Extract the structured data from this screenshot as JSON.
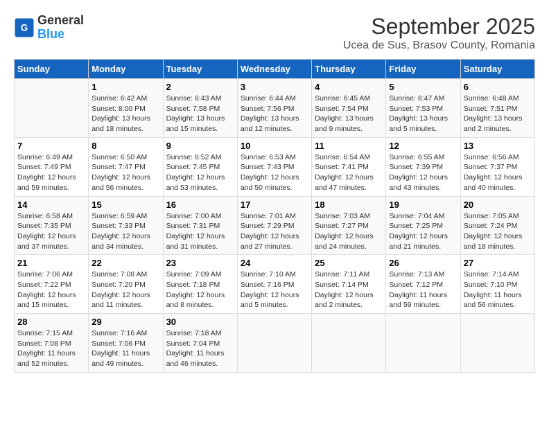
{
  "logo": {
    "general": "General",
    "blue": "Blue"
  },
  "title": "September 2025",
  "subtitle": "Ucea de Sus, Brasov County, Romania",
  "days_of_week": [
    "Sunday",
    "Monday",
    "Tuesday",
    "Wednesday",
    "Thursday",
    "Friday",
    "Saturday"
  ],
  "weeks": [
    [
      {
        "day": "",
        "info": ""
      },
      {
        "day": "1",
        "info": "Sunrise: 6:42 AM\nSunset: 8:00 PM\nDaylight: 13 hours\nand 18 minutes."
      },
      {
        "day": "2",
        "info": "Sunrise: 6:43 AM\nSunset: 7:58 PM\nDaylight: 13 hours\nand 15 minutes."
      },
      {
        "day": "3",
        "info": "Sunrise: 6:44 AM\nSunset: 7:56 PM\nDaylight: 13 hours\nand 12 minutes."
      },
      {
        "day": "4",
        "info": "Sunrise: 6:45 AM\nSunset: 7:54 PM\nDaylight: 13 hours\nand 9 minutes."
      },
      {
        "day": "5",
        "info": "Sunrise: 6:47 AM\nSunset: 7:53 PM\nDaylight: 13 hours\nand 5 minutes."
      },
      {
        "day": "6",
        "info": "Sunrise: 6:48 AM\nSunset: 7:51 PM\nDaylight: 13 hours\nand 2 minutes."
      }
    ],
    [
      {
        "day": "7",
        "info": "Sunrise: 6:49 AM\nSunset: 7:49 PM\nDaylight: 12 hours\nand 59 minutes."
      },
      {
        "day": "8",
        "info": "Sunrise: 6:50 AM\nSunset: 7:47 PM\nDaylight: 12 hours\nand 56 minutes."
      },
      {
        "day": "9",
        "info": "Sunrise: 6:52 AM\nSunset: 7:45 PM\nDaylight: 12 hours\nand 53 minutes."
      },
      {
        "day": "10",
        "info": "Sunrise: 6:53 AM\nSunset: 7:43 PM\nDaylight: 12 hours\nand 50 minutes."
      },
      {
        "day": "11",
        "info": "Sunrise: 6:54 AM\nSunset: 7:41 PM\nDaylight: 12 hours\nand 47 minutes."
      },
      {
        "day": "12",
        "info": "Sunrise: 6:55 AM\nSunset: 7:39 PM\nDaylight: 12 hours\nand 43 minutes."
      },
      {
        "day": "13",
        "info": "Sunrise: 6:56 AM\nSunset: 7:37 PM\nDaylight: 12 hours\nand 40 minutes."
      }
    ],
    [
      {
        "day": "14",
        "info": "Sunrise: 6:58 AM\nSunset: 7:35 PM\nDaylight: 12 hours\nand 37 minutes."
      },
      {
        "day": "15",
        "info": "Sunrise: 6:59 AM\nSunset: 7:33 PM\nDaylight: 12 hours\nand 34 minutes."
      },
      {
        "day": "16",
        "info": "Sunrise: 7:00 AM\nSunset: 7:31 PM\nDaylight: 12 hours\nand 31 minutes."
      },
      {
        "day": "17",
        "info": "Sunrise: 7:01 AM\nSunset: 7:29 PM\nDaylight: 12 hours\nand 27 minutes."
      },
      {
        "day": "18",
        "info": "Sunrise: 7:03 AM\nSunset: 7:27 PM\nDaylight: 12 hours\nand 24 minutes."
      },
      {
        "day": "19",
        "info": "Sunrise: 7:04 AM\nSunset: 7:25 PM\nDaylight: 12 hours\nand 21 minutes."
      },
      {
        "day": "20",
        "info": "Sunrise: 7:05 AM\nSunset: 7:24 PM\nDaylight: 12 hours\nand 18 minutes."
      }
    ],
    [
      {
        "day": "21",
        "info": "Sunrise: 7:06 AM\nSunset: 7:22 PM\nDaylight: 12 hours\nand 15 minutes."
      },
      {
        "day": "22",
        "info": "Sunrise: 7:08 AM\nSunset: 7:20 PM\nDaylight: 12 hours\nand 11 minutes."
      },
      {
        "day": "23",
        "info": "Sunrise: 7:09 AM\nSunset: 7:18 PM\nDaylight: 12 hours\nand 8 minutes."
      },
      {
        "day": "24",
        "info": "Sunrise: 7:10 AM\nSunset: 7:16 PM\nDaylight: 12 hours\nand 5 minutes."
      },
      {
        "day": "25",
        "info": "Sunrise: 7:11 AM\nSunset: 7:14 PM\nDaylight: 12 hours\nand 2 minutes."
      },
      {
        "day": "26",
        "info": "Sunrise: 7:13 AM\nSunset: 7:12 PM\nDaylight: 11 hours\nand 59 minutes."
      },
      {
        "day": "27",
        "info": "Sunrise: 7:14 AM\nSunset: 7:10 PM\nDaylight: 11 hours\nand 56 minutes."
      }
    ],
    [
      {
        "day": "28",
        "info": "Sunrise: 7:15 AM\nSunset: 7:08 PM\nDaylight: 11 hours\nand 52 minutes."
      },
      {
        "day": "29",
        "info": "Sunrise: 7:16 AM\nSunset: 7:06 PM\nDaylight: 11 hours\nand 49 minutes."
      },
      {
        "day": "30",
        "info": "Sunrise: 7:18 AM\nSunset: 7:04 PM\nDaylight: 11 hours\nand 46 minutes."
      },
      {
        "day": "",
        "info": ""
      },
      {
        "day": "",
        "info": ""
      },
      {
        "day": "",
        "info": ""
      },
      {
        "day": "",
        "info": ""
      }
    ]
  ]
}
